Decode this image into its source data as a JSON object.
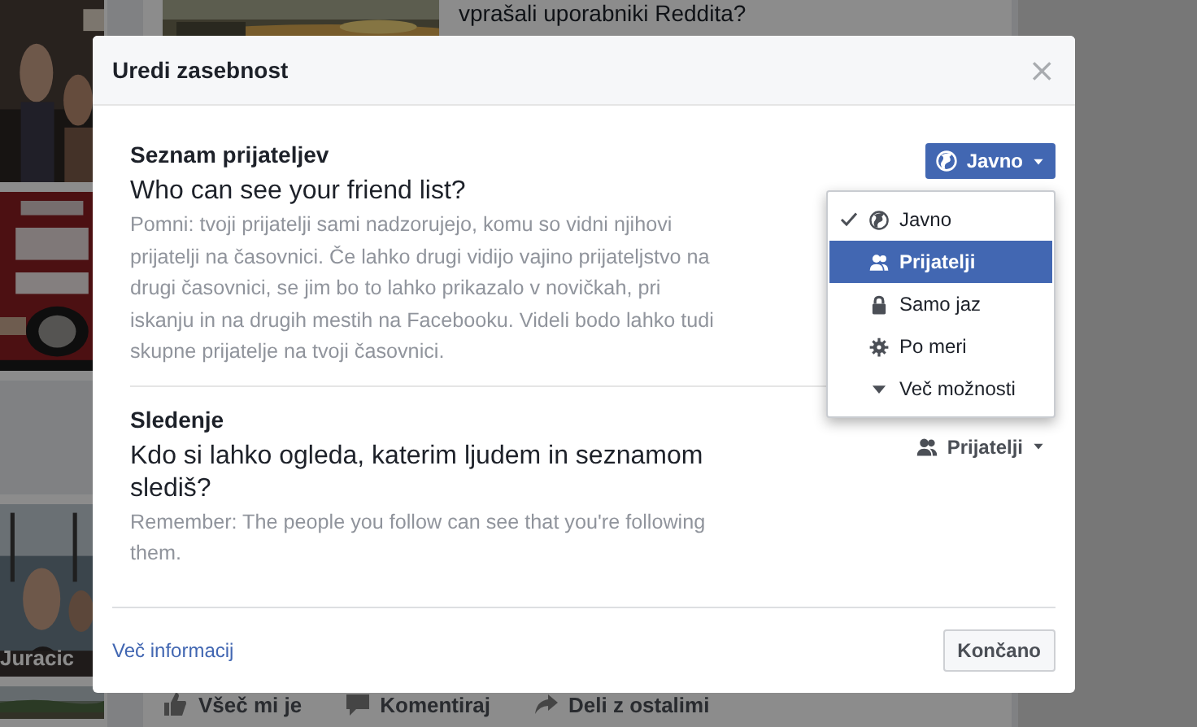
{
  "background": {
    "story_title": "vprašali uporabniki Reddita?",
    "photo_caption": "Juracic",
    "actions": [
      {
        "label": "Všeč mi je",
        "kind": "thumb"
      },
      {
        "label": "Komentiraj",
        "kind": "comment"
      },
      {
        "label": "Deli z ostalimi",
        "kind": "share"
      }
    ]
  },
  "dialog": {
    "title": "Uredi zasebnost",
    "close": "×",
    "sections": [
      {
        "title": "Seznam prijateljev",
        "question": "Who can see your friend list?",
        "hint": "Pomni: tvoji prijatelji sami nadzorujejo, komu so vidni njihovi prijatelji na časovnici. Če lahko drugi vidijo vajino prijateljstvo na drugi časovnici, se jim bo to lahko prikazalo v novičkah, pri iskanju in na drugih mestih na Facebooku. Videli bodo lahko tudi skupne prijatelje na tvoji časovnici.",
        "audience": {
          "label": "Javno",
          "kind": "globe",
          "open": true
        }
      },
      {
        "title": "Sledenje",
        "question": "Kdo si lahko ogleda, katerim ljudem in seznamom slediš?",
        "hint": "Remember: The people you follow can see that you're following them.",
        "audience": {
          "label": "Prijatelji",
          "kind": "friends",
          "open": false
        }
      }
    ],
    "menu": {
      "items": [
        {
          "label": "Javno",
          "kind": "globe",
          "checked": true,
          "selected": false
        },
        {
          "label": "Prijatelji",
          "kind": "friends",
          "checked": false,
          "selected": true
        },
        {
          "label": "Samo jaz",
          "kind": "lock",
          "checked": false,
          "selected": false
        },
        {
          "label": "Po meri",
          "kind": "gear",
          "checked": false,
          "selected": false
        },
        {
          "label": "Več možnosti",
          "kind": "caret",
          "checked": false,
          "selected": false
        }
      ]
    },
    "footer": {
      "link": "Več informacij",
      "button": "Končano"
    }
  }
}
